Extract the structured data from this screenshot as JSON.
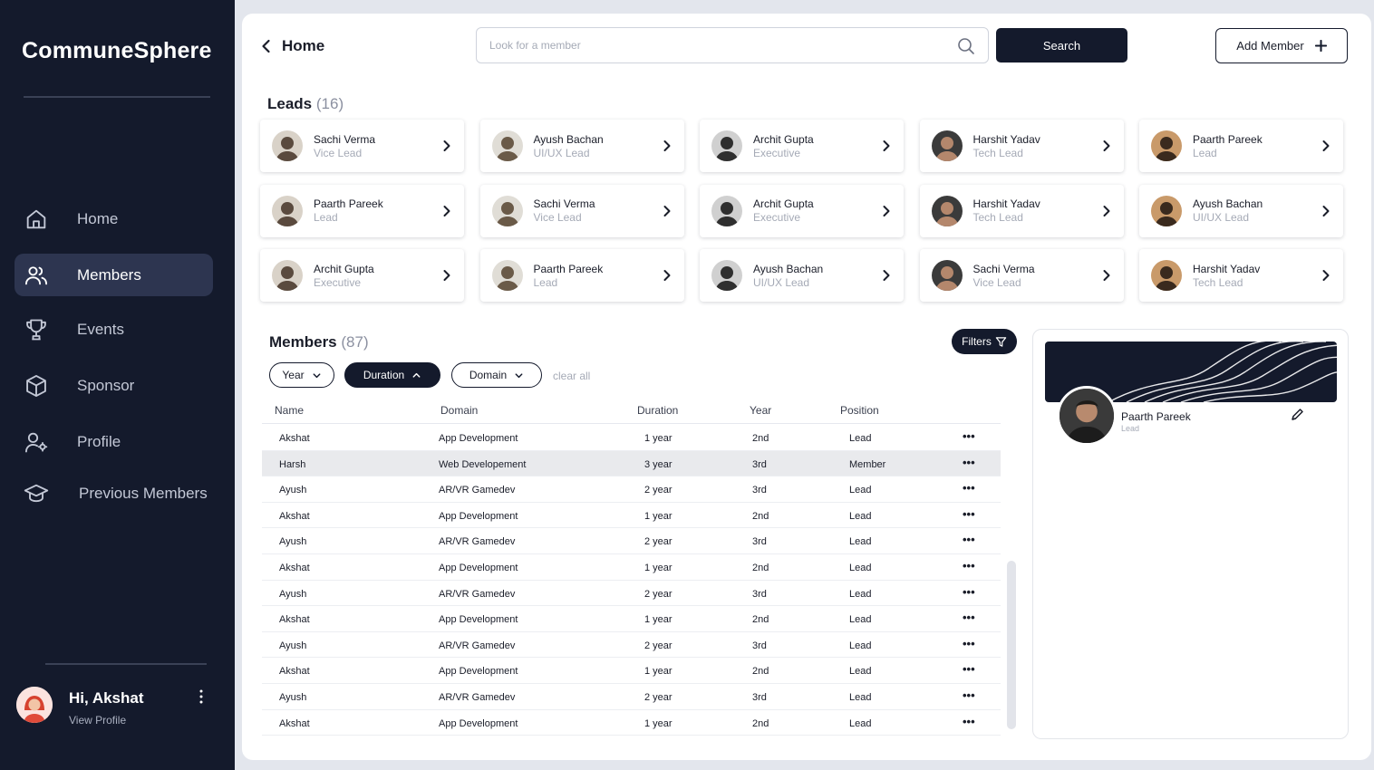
{
  "app": {
    "name": "CommuneSphere"
  },
  "sidebar": {
    "items": [
      {
        "label": "Home",
        "icon": "home-icon"
      },
      {
        "label": "Members",
        "icon": "users-icon",
        "active": true
      },
      {
        "label": "Events",
        "icon": "trophy-icon"
      },
      {
        "label": "Sponsor",
        "icon": "cube-icon"
      },
      {
        "label": "Profile",
        "icon": "user-gear-icon"
      },
      {
        "label": "Previous Members",
        "icon": "graduation-cap-icon"
      }
    ],
    "user": {
      "greeting": "Hi, Akshat",
      "link": "View Profile"
    }
  },
  "header": {
    "back_label": "Home",
    "search_placeholder": "Look for a member",
    "search_button": "Search",
    "add_member": "Add Member"
  },
  "leads": {
    "title": "Leads",
    "count": "(16)",
    "cards": [
      {
        "name": "Sachi Verma",
        "role": "Vice Lead"
      },
      {
        "name": "Ayush Bachan",
        "role": "UI/UX Lead"
      },
      {
        "name": "Archit Gupta",
        "role": "Executive"
      },
      {
        "name": "Harshit Yadav",
        "role": "Tech Lead"
      },
      {
        "name": "Paarth Pareek",
        "role": "Lead"
      },
      {
        "name": "Paarth Pareek",
        "role": "Lead"
      },
      {
        "name": "Sachi Verma",
        "role": "Vice Lead"
      },
      {
        "name": "Archit Gupta",
        "role": "Executive"
      },
      {
        "name": "Harshit Yadav",
        "role": "Tech Lead"
      },
      {
        "name": "Ayush Bachan",
        "role": "UI/UX Lead"
      },
      {
        "name": "Archit Gupta",
        "role": "Executive"
      },
      {
        "name": "Paarth Pareek",
        "role": "Lead"
      },
      {
        "name": "Ayush Bachan",
        "role": "UI/UX Lead"
      },
      {
        "name": "Sachi Verma",
        "role": "Vice Lead"
      },
      {
        "name": "Harshit Yadav",
        "role": "Tech Lead"
      }
    ]
  },
  "members": {
    "title": "Members",
    "count": "(87)",
    "filters_button": "Filters",
    "chips": [
      {
        "label": "Year",
        "active": false,
        "icon": "chevron-down-icon"
      },
      {
        "label": "Duration",
        "active": true,
        "icon": "chevron-up-icon"
      },
      {
        "label": "Domain",
        "active": false,
        "icon": "chevron-down-icon"
      }
    ],
    "clear_all": "clear all",
    "columns": [
      "Name",
      "Domain",
      "Duration",
      "Year",
      "Position"
    ],
    "rows": [
      [
        "Akshat",
        "App Development",
        "1 year",
        "2nd",
        "Lead"
      ],
      [
        "Harsh",
        "Web Developement",
        "3 year",
        "3rd",
        "Member"
      ],
      [
        "Ayush",
        "AR/VR Gamedev",
        "2 year",
        "3rd",
        "Lead"
      ],
      [
        "Akshat",
        "App Development",
        "1 year",
        "2nd",
        "Lead"
      ],
      [
        "Ayush",
        "AR/VR Gamedev",
        "2 year",
        "3rd",
        "Lead"
      ],
      [
        "Akshat",
        "App Development",
        "1 year",
        "2nd",
        "Lead"
      ],
      [
        "Ayush",
        "AR/VR Gamedev",
        "2 year",
        "3rd",
        "Lead"
      ],
      [
        "Akshat",
        "App Development",
        "1 year",
        "2nd",
        "Lead"
      ],
      [
        "Ayush",
        "AR/VR Gamedev",
        "2 year",
        "3rd",
        "Lead"
      ],
      [
        "Akshat",
        "App Development",
        "1 year",
        "2nd",
        "Lead"
      ],
      [
        "Ayush",
        "AR/VR Gamedev",
        "2 year",
        "3rd",
        "Lead"
      ],
      [
        "Akshat",
        "App Development",
        "1 year",
        "2nd",
        "Lead"
      ]
    ],
    "row_menu": "•••"
  },
  "profile_card": {
    "name": "Paarth Pareek",
    "role": "Lead"
  },
  "colors": {
    "sidebar_bg": "#141a2c",
    "accent": "#141a2c",
    "muted": "#a5aab6"
  }
}
